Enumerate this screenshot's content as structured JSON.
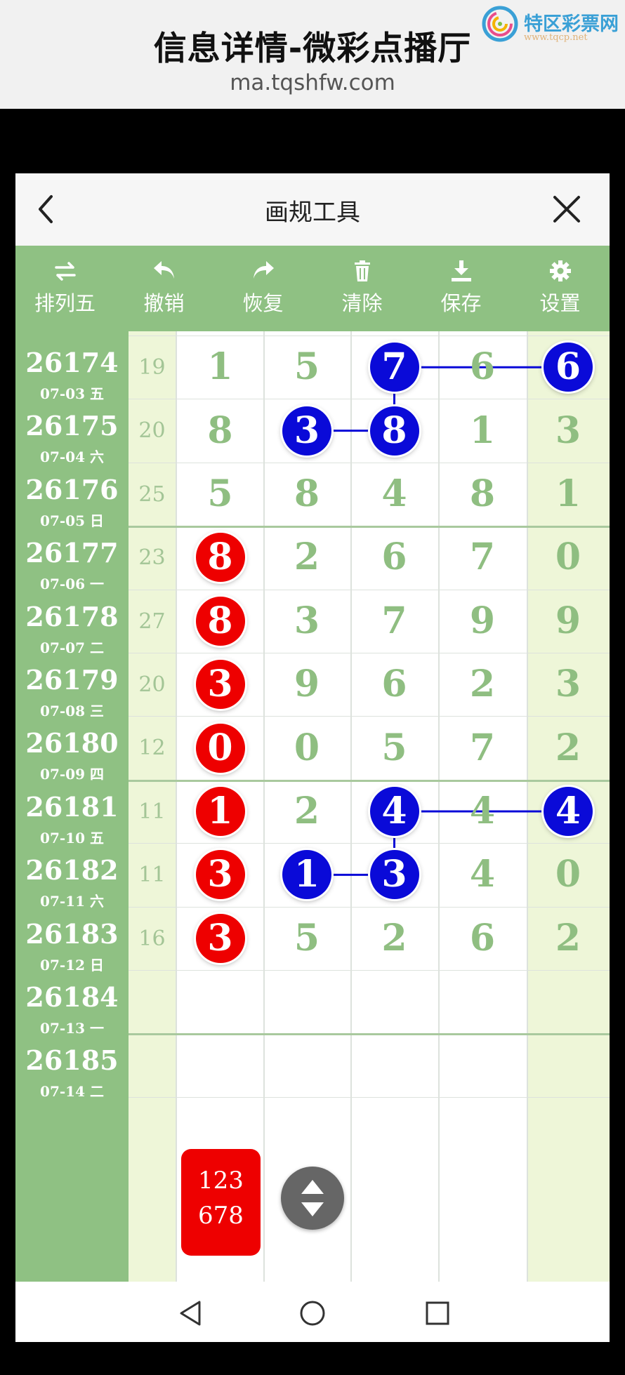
{
  "banner": {
    "title": "信息详情-微彩点播厅",
    "url": "ma.tqshfw.com",
    "logo_name": "特区彩票网",
    "logo_url": "www.tqcp.net"
  },
  "app": {
    "title": "画规工具"
  },
  "toolbar": {
    "items": [
      {
        "label": "排列五",
        "icon": "swap-arrows-icon"
      },
      {
        "label": "撤销",
        "icon": "undo-icon"
      },
      {
        "label": "恢复",
        "icon": "redo-icon"
      },
      {
        "label": "清除",
        "icon": "trash-icon"
      },
      {
        "label": "保存",
        "icon": "download-icon"
      },
      {
        "label": "设置",
        "icon": "gear-icon"
      }
    ]
  },
  "rows": [
    {
      "issue": "26174",
      "date": "07-03 五",
      "sum": "19",
      "digits": [
        "1",
        "5",
        "7",
        "6",
        "6"
      ]
    },
    {
      "issue": "26175",
      "date": "07-04 六",
      "sum": "20",
      "digits": [
        "8",
        "3",
        "8",
        "1",
        "3"
      ]
    },
    {
      "issue": "26176",
      "date": "07-05 日",
      "sum": "25",
      "digits": [
        "5",
        "8",
        "4",
        "8",
        "1"
      ]
    },
    {
      "issue": "26177",
      "date": "07-06 一",
      "sum": "23",
      "digits": [
        "8",
        "2",
        "6",
        "7",
        "0"
      ]
    },
    {
      "issue": "26178",
      "date": "07-07 二",
      "sum": "27",
      "digits": [
        "8",
        "3",
        "7",
        "9",
        "9"
      ]
    },
    {
      "issue": "26179",
      "date": "07-08 三",
      "sum": "20",
      "digits": [
        "3",
        "9",
        "6",
        "2",
        "3"
      ]
    },
    {
      "issue": "26180",
      "date": "07-09 四",
      "sum": "12",
      "digits": [
        "0",
        "0",
        "5",
        "7",
        "2"
      ]
    },
    {
      "issue": "26181",
      "date": "07-10 五",
      "sum": "11",
      "digits": [
        "1",
        "2",
        "4",
        "4",
        "4"
      ]
    },
    {
      "issue": "26182",
      "date": "07-11 六",
      "sum": "11",
      "digits": [
        "3",
        "1",
        "3",
        "4",
        "0"
      ]
    },
    {
      "issue": "26183",
      "date": "07-12 日",
      "sum": "16",
      "digits": [
        "3",
        "5",
        "2",
        "6",
        "2"
      ]
    },
    {
      "issue": "26184",
      "date": "07-13 一",
      "sum": "",
      "digits": [
        "",
        "",
        "",
        "",
        ""
      ]
    },
    {
      "issue": "26185",
      "date": "07-14 二",
      "sum": "",
      "digits": [
        "",
        "",
        "",
        "",
        ""
      ]
    }
  ],
  "marks": [
    {
      "row": 0,
      "col": 2,
      "color": "blue"
    },
    {
      "row": 0,
      "col": 4,
      "color": "blue"
    },
    {
      "row": 1,
      "col": 1,
      "color": "blue"
    },
    {
      "row": 1,
      "col": 2,
      "color": "blue"
    },
    {
      "row": 3,
      "col": 0,
      "color": "red"
    },
    {
      "row": 4,
      "col": 0,
      "color": "red"
    },
    {
      "row": 5,
      "col": 0,
      "color": "red"
    },
    {
      "row": 6,
      "col": 0,
      "color": "red"
    },
    {
      "row": 7,
      "col": 0,
      "color": "red"
    },
    {
      "row": 8,
      "col": 0,
      "color": "red"
    },
    {
      "row": 9,
      "col": 0,
      "color": "red"
    },
    {
      "row": 7,
      "col": 2,
      "color": "blue"
    },
    {
      "row": 7,
      "col": 4,
      "color": "blue"
    },
    {
      "row": 8,
      "col": 1,
      "color": "blue"
    },
    {
      "row": 8,
      "col": 2,
      "color": "blue"
    }
  ],
  "links": [
    [
      [
        0,
        2
      ],
      [
        0,
        4
      ]
    ],
    [
      [
        0,
        2
      ],
      [
        1,
        2
      ]
    ],
    [
      [
        1,
        1
      ],
      [
        1,
        2
      ]
    ],
    [
      [
        7,
        2
      ],
      [
        7,
        4
      ]
    ],
    [
      [
        7,
        2
      ],
      [
        8,
        2
      ]
    ],
    [
      [
        8,
        1
      ],
      [
        8,
        2
      ]
    ]
  ],
  "prediction": {
    "top": "123",
    "bottom": "678"
  },
  "colors": {
    "green": "#8fc183",
    "red": "#ee0000",
    "blue": "#0a0ad8",
    "pale": "#eef6d8"
  }
}
